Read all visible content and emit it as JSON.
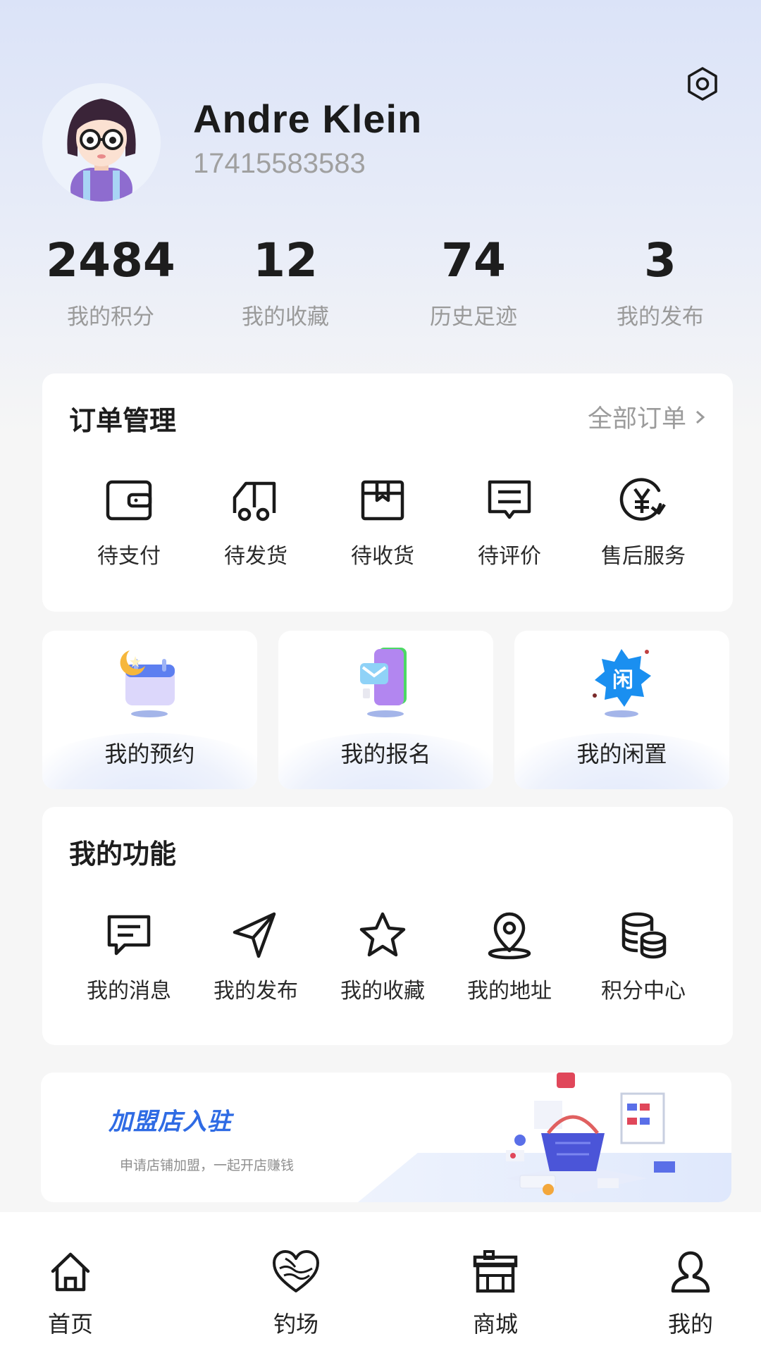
{
  "profile": {
    "name": "Andre Klein",
    "phone": "17415583583"
  },
  "stats": [
    {
      "value": "2484",
      "label": "我的积分"
    },
    {
      "value": "12",
      "label": "我的收藏"
    },
    {
      "value": "74",
      "label": "历史足迹"
    },
    {
      "value": "3",
      "label": "我的发布"
    }
  ],
  "orders": {
    "title": "订单管理",
    "all_label": "全部订单",
    "items": [
      {
        "label": "待支付",
        "icon": "wallet-icon"
      },
      {
        "label": "待发货",
        "icon": "truck-icon"
      },
      {
        "label": "待收货",
        "icon": "package-icon"
      },
      {
        "label": "待评价",
        "icon": "comment-icon"
      },
      {
        "label": "售后服务",
        "icon": "yen-refresh-icon"
      }
    ]
  },
  "features": [
    {
      "label": "我的预约",
      "icon": "calendar-moon-icon"
    },
    {
      "label": "我的报名",
      "icon": "phone-mail-icon"
    },
    {
      "label": "我的闲置",
      "icon": "idle-badge-icon",
      "badge_text": "闲"
    }
  ],
  "functions": {
    "title": "我的功能",
    "items": [
      {
        "label": "我的消息",
        "icon": "message-icon"
      },
      {
        "label": "我的发布",
        "icon": "send-icon"
      },
      {
        "label": "我的收藏",
        "icon": "star-icon"
      },
      {
        "label": "我的地址",
        "icon": "location-icon"
      },
      {
        "label": "积分中心",
        "icon": "coins-icon"
      }
    ]
  },
  "banner": {
    "title": "加盟店入驻",
    "subtitle": "申请店铺加盟，一起开店赚钱"
  },
  "tabbar": [
    {
      "label": "首页",
      "icon": "home-icon"
    },
    {
      "label": "钓场",
      "icon": "fishing-heart-icon"
    },
    {
      "label": "商城",
      "icon": "store-icon"
    },
    {
      "label": "我的",
      "icon": "user-icon"
    }
  ],
  "colors": {
    "accent": "#2f6be4",
    "header_bg": "#dbe3f8"
  }
}
